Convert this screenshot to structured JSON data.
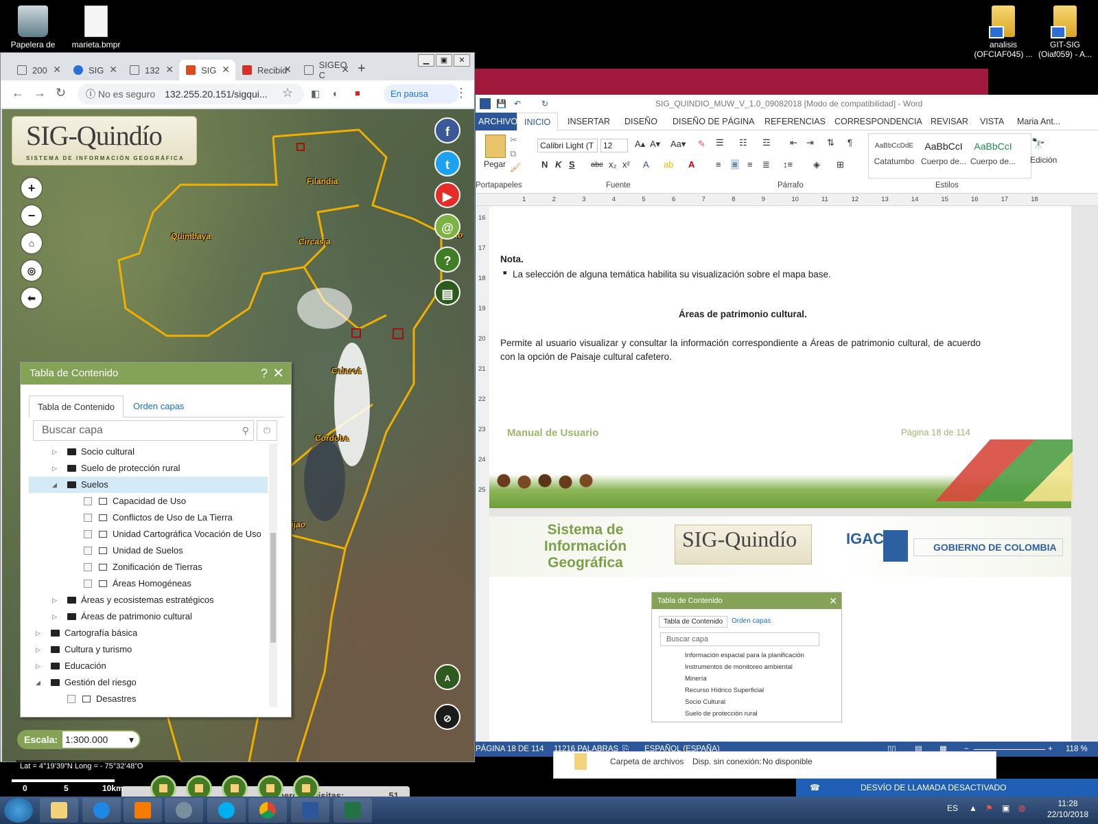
{
  "desktop": {
    "icons": [
      {
        "label": "Papelera de",
        "icon": "recycle-bin-icon"
      },
      {
        "label": "marieta.bmpr",
        "icon": "file-icon"
      },
      {
        "label": "analisis (OFCIAF045) ...",
        "icon": "network-folder-icon"
      },
      {
        "label": "GIT-SIG (Oiaf059) - A...",
        "icon": "network-folder-icon"
      }
    ]
  },
  "chrome": {
    "tabs": [
      {
        "label": "200",
        "icon": "document-icon"
      },
      {
        "label": "SIG",
        "icon": "globe-icon"
      },
      {
        "label": "132",
        "icon": "document-icon"
      },
      {
        "label": "SIG",
        "icon": "sig-bird-icon"
      },
      {
        "label": "Recibid",
        "icon": "gmail-icon"
      },
      {
        "label": "SIGEO C",
        "icon": "document-icon"
      }
    ],
    "active_tab_index": 3,
    "address": {
      "security": "No es seguro",
      "url": "132.255.20.151/sigqui..."
    },
    "pause_label": "En pausa"
  },
  "map": {
    "logo": {
      "title": "SIG-Quindío",
      "subtitle": "SISTEMA DE INFORMACIÓN GEOGRÁFICA"
    },
    "towns": [
      "Filandia",
      "Quimbaya",
      "Circasia",
      "Calarcá",
      "Córdoba",
      "jijao",
      "ento"
    ],
    "controls": [
      "zoom-in",
      "zoom-out",
      "home",
      "locate",
      "back"
    ],
    "social": [
      "facebook",
      "twitter",
      "youtube",
      "email",
      "help",
      "layers"
    ],
    "escala_label": "Escala:",
    "escala_value": "1:300.000",
    "coords": "Lat = 4°19’39”N Long = - 75°32’48”O",
    "scale_ticks": [
      "0",
      "5",
      "10km"
    ],
    "visits_label": "Número de visitas:",
    "visits_count": "51"
  },
  "toc": {
    "title": "Tabla de Contenido",
    "help": "?",
    "close": "✕",
    "tabs": [
      "Tabla de Contenido",
      "Orden capas"
    ],
    "search_placeholder": "Buscar capa",
    "nodes": [
      {
        "label": "Socio cultural",
        "level": 1,
        "type": "folder",
        "state": "collapsed"
      },
      {
        "label": "Suelo de protección rural",
        "level": 1,
        "type": "folder",
        "state": "collapsed"
      },
      {
        "label": "Suelos",
        "level": 1,
        "type": "folder",
        "state": "expanded",
        "selected": true
      },
      {
        "label": "Capacidad de Uso",
        "level": 2,
        "type": "layer"
      },
      {
        "label": "Conflictos de Uso de La Tierra",
        "level": 2,
        "type": "layer"
      },
      {
        "label": "Unidad Cartográfica Vocación de Uso",
        "level": 2,
        "type": "layer"
      },
      {
        "label": "Unidad de Suelos",
        "level": 2,
        "type": "layer"
      },
      {
        "label": "Zonificación de Tierras",
        "level": 2,
        "type": "layer"
      },
      {
        "label": "Áreas Homogéneas",
        "level": 2,
        "type": "layer"
      },
      {
        "label": "Áreas y ecosistemas estratégicos",
        "level": 1,
        "type": "folder",
        "state": "collapsed"
      },
      {
        "label": "Áreas de patrimonio cultural",
        "level": 1,
        "type": "folder",
        "state": "collapsed"
      },
      {
        "label": "Cartografía básica",
        "level": 0,
        "type": "folder",
        "state": "collapsed"
      },
      {
        "label": "Cultura y turismo",
        "level": 0,
        "type": "folder",
        "state": "collapsed"
      },
      {
        "label": "Educación",
        "level": 0,
        "type": "folder",
        "state": "collapsed"
      },
      {
        "label": "Gestión del riesgo",
        "level": 0,
        "type": "folder",
        "state": "expanded"
      },
      {
        "label": "Desastres",
        "level": 1,
        "type": "layer"
      }
    ]
  },
  "word": {
    "title": "SIG_QUINDIO_MUW_V_1.0_09082018 [Modo de compatibilidad] - Word",
    "tabs": [
      "ARCHIVO",
      "INICIO",
      "INSERTAR",
      "DISEÑO",
      "DISEÑO DE PÁGINA",
      "REFERENCIAS",
      "CORRESPONDENCIA",
      "REVISAR",
      "VISTA"
    ],
    "user": "Maria Ant...",
    "ribbon": {
      "paste": "Pegar",
      "font_name": "Calibri Light (T",
      "font_size": "12",
      "groups": [
        "Portapapeles",
        "Fuente",
        "Párrafo",
        "Estilos",
        "Edición"
      ],
      "styles": [
        {
          "preview": "AaBbCcDdE",
          "name": "Catatumbo"
        },
        {
          "preview": "AaBbCcI",
          "name": "Cuerpo de..."
        },
        {
          "preview": "AaBbCcI",
          "name": "Cuerpo de..."
        }
      ],
      "format_buttons": [
        "N",
        "K",
        "S",
        "abc",
        "x₂",
        "x²"
      ]
    },
    "ruler_marks": [
      "1",
      "2",
      "3",
      "4",
      "5",
      "6",
      "7",
      "8",
      "9",
      "10",
      "11",
      "12",
      "13",
      "14",
      "15",
      "16",
      "17",
      "18"
    ],
    "vruler_marks": [
      "16",
      "17",
      "18",
      "19",
      "20",
      "21",
      "22",
      "23",
      "24",
      "25"
    ],
    "doc": {
      "nota": "Nota.",
      "bullet": "La selección de alguna temática habilita su visualización sobre el mapa base.",
      "heading": "Áreas de patrimonio cultural.",
      "paragraph": "Permite al usuario visualizar y consultar la información correspondiente a Áreas de patrimonio cultural, de acuerdo con la opción de Paisaje cultural cafetero.",
      "footer_left": "Manual de Usuario",
      "footer_right": "Página 18 de 114",
      "header_title": "Sistema de Información Geográfica",
      "header_logo": "SIG-Quindío",
      "igac": "IGAC",
      "gobierno": "GOBIERNO DE COLOMBIA"
    },
    "mini_toc": {
      "title": "Tabla de Contenido",
      "tabs": [
        "Tabla de Contenido",
        "Orden capas"
      ],
      "search_placeholder": "Buscar capa",
      "nodes": [
        "Información espacial para la planificación",
        "Instrumentos de monitoreo ambiental",
        "Minería",
        "Recurso Hídrico Superficial",
        "Socio Cultural",
        "Suelo de protección rural"
      ]
    },
    "status": {
      "page": "PÁGINA 18 DE 114",
      "words": "11216 PALABRAS",
      "language": "ESPAÑOL (ESPAÑA)",
      "zoom": "118 %"
    }
  },
  "explorer": {
    "item": "Carpeta de archivos",
    "offline_label": "Disp. sin conexión:",
    "offline_value": "No disponible"
  },
  "callbar": {
    "text": "DESVÍO DE LLAMADA DESACTIVADO"
  },
  "taskbar": {
    "apps": [
      "file-explorer",
      "internet-explorer",
      "media-player",
      "tortoise",
      "skype",
      "chrome",
      "word",
      "excel"
    ],
    "lang": "ES",
    "time": "11:28",
    "date": "22/10/2018"
  }
}
